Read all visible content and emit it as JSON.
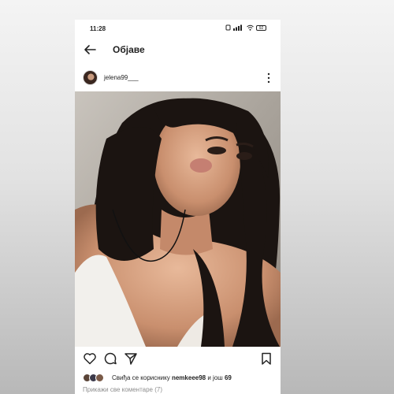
{
  "status_bar": {
    "time": "11:28",
    "battery": "92"
  },
  "header": {
    "title": "Објаве"
  },
  "post": {
    "username": "jelena99___",
    "likes": {
      "prefix": "Свиђа се кориснику",
      "user": "nemkeee98",
      "middle": "и још",
      "count": "69"
    },
    "comments_link": "Прикажи све коментаре (7)"
  },
  "colors": {
    "text": "#222222",
    "muted": "#8e8e8e",
    "background": "#ffffff"
  }
}
